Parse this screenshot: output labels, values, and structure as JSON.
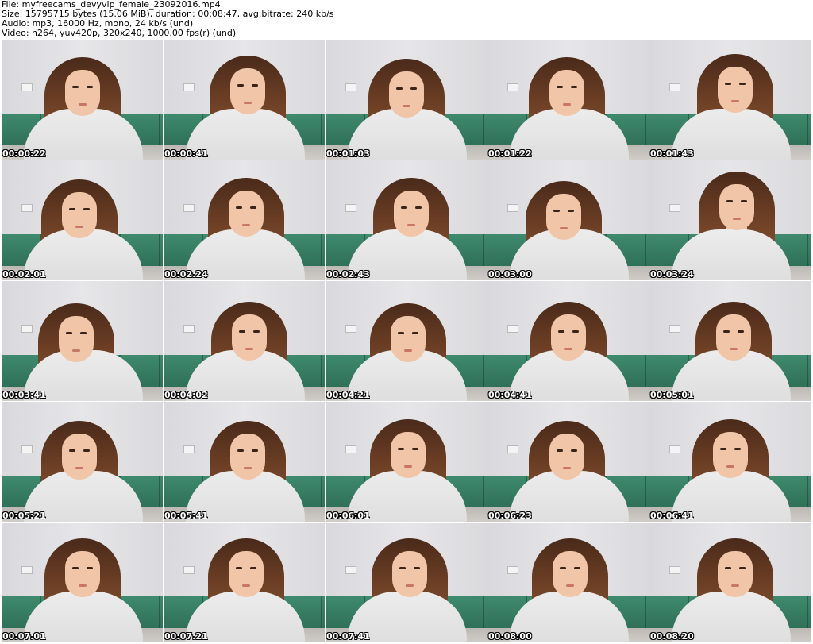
{
  "header": {
    "file_line": "File: myfreecams_devyvip_female_23092016.mp4",
    "size_line": "Size: 15795715 bytes (15.06 MiB), duration: 00:08:47, avg.bitrate: 240 kb/s",
    "audio_line": "Audio: mp3, 16000 Hz, mono, 24 kb/s (und)",
    "video_line": "Video: h264, yuv420p, 320x240, 1000.00 fps(r) (und)"
  },
  "thumbnails": [
    {
      "timestamp": "00:00:22"
    },
    {
      "timestamp": "00:00:41"
    },
    {
      "timestamp": "00:01:03"
    },
    {
      "timestamp": "00:01:22"
    },
    {
      "timestamp": "00:01:43"
    },
    {
      "timestamp": "00:02:01"
    },
    {
      "timestamp": "00:02:24"
    },
    {
      "timestamp": "00:02:43"
    },
    {
      "timestamp": "00:03:00"
    },
    {
      "timestamp": "00:03:24"
    },
    {
      "timestamp": "00:03:41"
    },
    {
      "timestamp": "00:04:02"
    },
    {
      "timestamp": "00:04:21"
    },
    {
      "timestamp": "00:04:41"
    },
    {
      "timestamp": "00:05:01"
    },
    {
      "timestamp": "00:05:21"
    },
    {
      "timestamp": "00:05:41"
    },
    {
      "timestamp": "00:06:01"
    },
    {
      "timestamp": "00:06:23"
    },
    {
      "timestamp": "00:06:41"
    },
    {
      "timestamp": "00:07:01"
    },
    {
      "timestamp": "00:07:21"
    },
    {
      "timestamp": "00:07:41"
    },
    {
      "timestamp": "00:08:00"
    },
    {
      "timestamp": "00:08:20"
    }
  ]
}
